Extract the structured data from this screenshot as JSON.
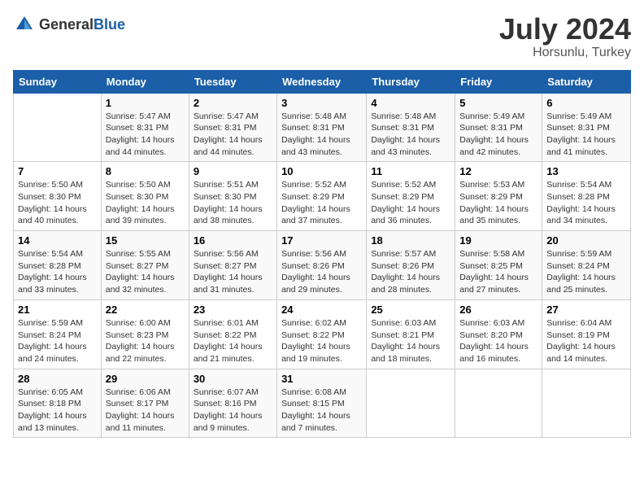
{
  "header": {
    "logo_general": "General",
    "logo_blue": "Blue",
    "title": "July 2024",
    "location": "Horsunlu, Turkey"
  },
  "weekdays": [
    "Sunday",
    "Monday",
    "Tuesday",
    "Wednesday",
    "Thursday",
    "Friday",
    "Saturday"
  ],
  "weeks": [
    [
      {
        "day": "",
        "info": ""
      },
      {
        "day": "1",
        "info": "Sunrise: 5:47 AM\nSunset: 8:31 PM\nDaylight: 14 hours\nand 44 minutes."
      },
      {
        "day": "2",
        "info": "Sunrise: 5:47 AM\nSunset: 8:31 PM\nDaylight: 14 hours\nand 44 minutes."
      },
      {
        "day": "3",
        "info": "Sunrise: 5:48 AM\nSunset: 8:31 PM\nDaylight: 14 hours\nand 43 minutes."
      },
      {
        "day": "4",
        "info": "Sunrise: 5:48 AM\nSunset: 8:31 PM\nDaylight: 14 hours\nand 43 minutes."
      },
      {
        "day": "5",
        "info": "Sunrise: 5:49 AM\nSunset: 8:31 PM\nDaylight: 14 hours\nand 42 minutes."
      },
      {
        "day": "6",
        "info": "Sunrise: 5:49 AM\nSunset: 8:31 PM\nDaylight: 14 hours\nand 41 minutes."
      }
    ],
    [
      {
        "day": "7",
        "info": "Sunrise: 5:50 AM\nSunset: 8:30 PM\nDaylight: 14 hours\nand 40 minutes."
      },
      {
        "day": "8",
        "info": "Sunrise: 5:50 AM\nSunset: 8:30 PM\nDaylight: 14 hours\nand 39 minutes."
      },
      {
        "day": "9",
        "info": "Sunrise: 5:51 AM\nSunset: 8:30 PM\nDaylight: 14 hours\nand 38 minutes."
      },
      {
        "day": "10",
        "info": "Sunrise: 5:52 AM\nSunset: 8:29 PM\nDaylight: 14 hours\nand 37 minutes."
      },
      {
        "day": "11",
        "info": "Sunrise: 5:52 AM\nSunset: 8:29 PM\nDaylight: 14 hours\nand 36 minutes."
      },
      {
        "day": "12",
        "info": "Sunrise: 5:53 AM\nSunset: 8:29 PM\nDaylight: 14 hours\nand 35 minutes."
      },
      {
        "day": "13",
        "info": "Sunrise: 5:54 AM\nSunset: 8:28 PM\nDaylight: 14 hours\nand 34 minutes."
      }
    ],
    [
      {
        "day": "14",
        "info": "Sunrise: 5:54 AM\nSunset: 8:28 PM\nDaylight: 14 hours\nand 33 minutes."
      },
      {
        "day": "15",
        "info": "Sunrise: 5:55 AM\nSunset: 8:27 PM\nDaylight: 14 hours\nand 32 minutes."
      },
      {
        "day": "16",
        "info": "Sunrise: 5:56 AM\nSunset: 8:27 PM\nDaylight: 14 hours\nand 31 minutes."
      },
      {
        "day": "17",
        "info": "Sunrise: 5:56 AM\nSunset: 8:26 PM\nDaylight: 14 hours\nand 29 minutes."
      },
      {
        "day": "18",
        "info": "Sunrise: 5:57 AM\nSunset: 8:26 PM\nDaylight: 14 hours\nand 28 minutes."
      },
      {
        "day": "19",
        "info": "Sunrise: 5:58 AM\nSunset: 8:25 PM\nDaylight: 14 hours\nand 27 minutes."
      },
      {
        "day": "20",
        "info": "Sunrise: 5:59 AM\nSunset: 8:24 PM\nDaylight: 14 hours\nand 25 minutes."
      }
    ],
    [
      {
        "day": "21",
        "info": "Sunrise: 5:59 AM\nSunset: 8:24 PM\nDaylight: 14 hours\nand 24 minutes."
      },
      {
        "day": "22",
        "info": "Sunrise: 6:00 AM\nSunset: 8:23 PM\nDaylight: 14 hours\nand 22 minutes."
      },
      {
        "day": "23",
        "info": "Sunrise: 6:01 AM\nSunset: 8:22 PM\nDaylight: 14 hours\nand 21 minutes."
      },
      {
        "day": "24",
        "info": "Sunrise: 6:02 AM\nSunset: 8:22 PM\nDaylight: 14 hours\nand 19 minutes."
      },
      {
        "day": "25",
        "info": "Sunrise: 6:03 AM\nSunset: 8:21 PM\nDaylight: 14 hours\nand 18 minutes."
      },
      {
        "day": "26",
        "info": "Sunrise: 6:03 AM\nSunset: 8:20 PM\nDaylight: 14 hours\nand 16 minutes."
      },
      {
        "day": "27",
        "info": "Sunrise: 6:04 AM\nSunset: 8:19 PM\nDaylight: 14 hours\nand 14 minutes."
      }
    ],
    [
      {
        "day": "28",
        "info": "Sunrise: 6:05 AM\nSunset: 8:18 PM\nDaylight: 14 hours\nand 13 minutes."
      },
      {
        "day": "29",
        "info": "Sunrise: 6:06 AM\nSunset: 8:17 PM\nDaylight: 14 hours\nand 11 minutes."
      },
      {
        "day": "30",
        "info": "Sunrise: 6:07 AM\nSunset: 8:16 PM\nDaylight: 14 hours\nand 9 minutes."
      },
      {
        "day": "31",
        "info": "Sunrise: 6:08 AM\nSunset: 8:15 PM\nDaylight: 14 hours\nand 7 minutes."
      },
      {
        "day": "",
        "info": ""
      },
      {
        "day": "",
        "info": ""
      },
      {
        "day": "",
        "info": ""
      }
    ]
  ]
}
